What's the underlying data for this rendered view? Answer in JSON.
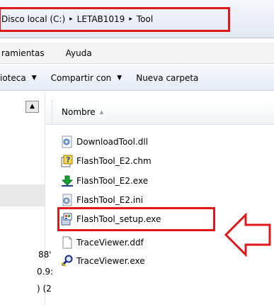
{
  "address_bar": {
    "crumbs": [
      "Disco local (C:)",
      "LETAB1019",
      "Tool"
    ],
    "separator": "▸"
  },
  "menu": {
    "items": [
      "ramientas",
      "Ayuda"
    ]
  },
  "toolbar": {
    "items": [
      "ioteca",
      "Compartir con",
      "Nueva carpeta"
    ]
  },
  "columns": {
    "name": "Nombre"
  },
  "files": [
    {
      "name": "DownloadTool.dll",
      "icon": "dll-file-icon"
    },
    {
      "name": "FlashTool_E2.chm",
      "icon": "chm-help-file-icon"
    },
    {
      "name": "FlashTool_E2.exe",
      "icon": "download-exe-icon"
    },
    {
      "name": "FlashTool_E2.ini",
      "icon": "ini-config-file-icon"
    },
    {
      "name": "FlashTool_setup.exe",
      "icon": "setup-installer-icon",
      "highlighted": true
    },
    {
      "name": "TraceViewer.ddf",
      "icon": "blank-file-icon"
    },
    {
      "name": "TraceViewer.exe",
      "icon": "magnifier-exe-icon"
    }
  ],
  "nav_pane_fragments": [
    "88'",
    "0.9:",
    ") (2"
  ],
  "colors": {
    "highlight_red": "#e0181b",
    "toolbar_bg": "#e5ecf6",
    "arrow_fill": "#ffffff"
  }
}
